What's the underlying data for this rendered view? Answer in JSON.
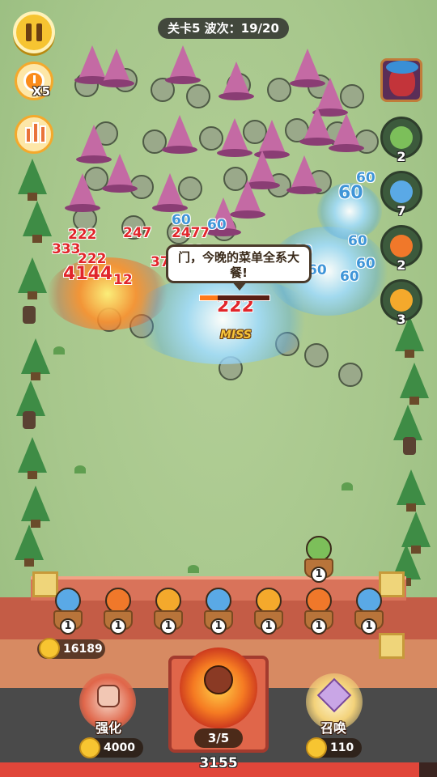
{
  "hud": {
    "level_wave": "关卡5 波次：19/20",
    "speed_label": "X5"
  },
  "enemy_queue": [
    {
      "name": "boss",
      "count": ""
    },
    {
      "name": "green-zombie",
      "count": "2"
    },
    {
      "name": "blue-mushroom",
      "count": "7"
    },
    {
      "name": "fire-imp",
      "count": "2"
    },
    {
      "name": "sunflower",
      "count": "3"
    }
  ],
  "battle": {
    "speech": "门，今晚的菜单全系大餐!",
    "miss_label": "MISS",
    "boss_hp_fraction": 0.25,
    "damage_numbers": [
      {
        "text": "222",
        "color": "red"
      },
      {
        "text": "333",
        "color": "red"
      },
      {
        "text": "247",
        "color": "red"
      },
      {
        "text": "2477",
        "color": "red"
      },
      {
        "text": "222",
        "color": "red"
      },
      {
        "text": "4144",
        "color": "red"
      },
      {
        "text": "12",
        "color": "red"
      },
      {
        "text": "371",
        "color": "red"
      },
      {
        "text": "222",
        "color": "red"
      },
      {
        "text": "222",
        "color": "red"
      },
      {
        "text": "222",
        "color": "red"
      },
      {
        "text": "60",
        "color": "blue"
      },
      {
        "text": "60",
        "color": "blue"
      },
      {
        "text": "60",
        "color": "blue"
      },
      {
        "text": "60",
        "color": "blue"
      },
      {
        "text": "60",
        "color": "blue"
      },
      {
        "text": "60",
        "color": "blue"
      },
      {
        "text": "60",
        "color": "blue"
      },
      {
        "text": "60",
        "color": "blue"
      },
      {
        "text": "60",
        "color": "blue"
      },
      {
        "text": "60",
        "color": "blue"
      },
      {
        "text": "60",
        "color": "blue"
      }
    ]
  },
  "defenders": [
    {
      "name": "blue-mushroom",
      "level": "1",
      "color": "#5aa9e6"
    },
    {
      "name": "fire-imp",
      "level": "1",
      "color": "#f0782a"
    },
    {
      "name": "sunflower",
      "level": "1",
      "color": "#f4a92c"
    },
    {
      "name": "blue-mushroom",
      "level": "1",
      "color": "#5aa9e6"
    },
    {
      "name": "sunflower",
      "level": "1",
      "color": "#f4a92c"
    },
    {
      "name": "fire-imp",
      "level": "1",
      "color": "#f0782a"
    },
    {
      "name": "blue-mushroom",
      "level": "1",
      "color": "#5aa9e6"
    }
  ],
  "extra_defender": {
    "name": "green-zombie",
    "level": "1",
    "color": "#7cbf5a"
  },
  "economy": {
    "gold": "16189",
    "upgrade_label": "强化",
    "upgrade_cost": "4000",
    "summon_label": "召唤",
    "summon_cost": "110"
  },
  "castle": {
    "wave_counter": "3/5",
    "hp": "3155",
    "hp_fraction": 0.96
  },
  "colors": {
    "accent": "#f6c431",
    "wall": "#c45c46",
    "damage_red": "#e1262b",
    "damage_blue": "#3f95d8"
  }
}
